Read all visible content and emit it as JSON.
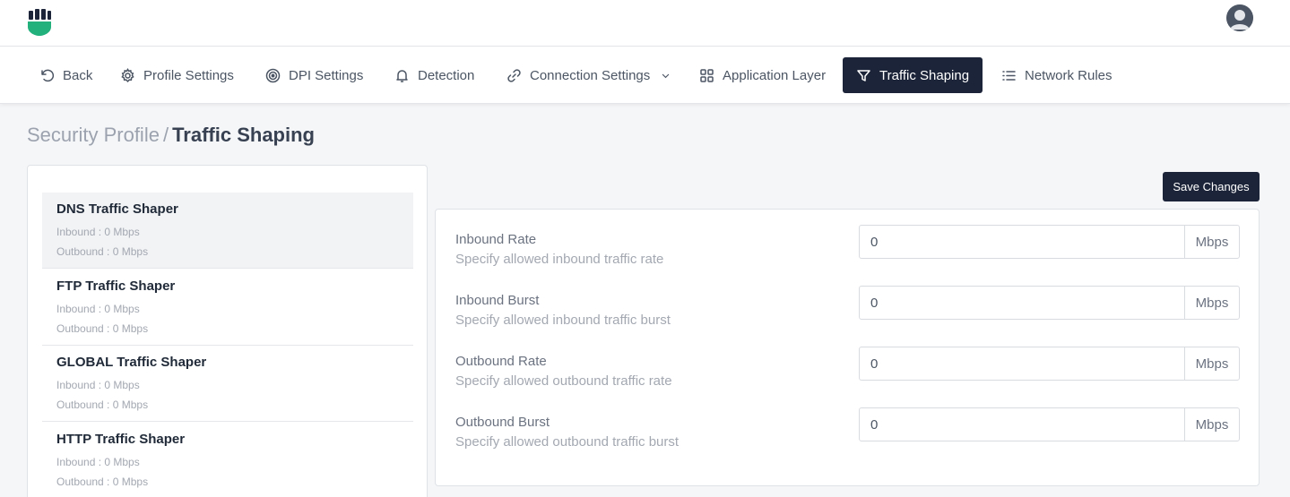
{
  "nav": {
    "back": "Back",
    "profile_settings": "Profile Settings",
    "dpi_settings": "DPI Settings",
    "detection": "Detection",
    "connection_settings": "Connection Settings",
    "application_layer": "Application Layer",
    "traffic_shaping": "Traffic Shaping",
    "network_rules": "Network Rules"
  },
  "breadcrumb": {
    "parent": "Security Profile",
    "separator": "/",
    "current": "Traffic Shaping"
  },
  "shapers": [
    {
      "title": "DNS Traffic Shaper",
      "inbound": "Inbound : 0 Mbps",
      "outbound": "Outbound : 0 Mbps",
      "selected": true
    },
    {
      "title": "FTP Traffic Shaper",
      "inbound": "Inbound : 0 Mbps",
      "outbound": "Outbound : 0 Mbps"
    },
    {
      "title": "GLOBAL Traffic Shaper",
      "inbound": "Inbound : 0 Mbps",
      "outbound": "Outbound : 0 Mbps"
    },
    {
      "title": "HTTP Traffic Shaper",
      "inbound": "Inbound : 0 Mbps",
      "outbound": "Outbound : 0 Mbps"
    }
  ],
  "save_label": "Save Changes",
  "fields": [
    {
      "label": "Inbound Rate",
      "help": "Specify allowed inbound traffic rate",
      "value": "0",
      "unit": "Mbps"
    },
    {
      "label": "Inbound Burst",
      "help": "Specify allowed inbound traffic burst",
      "value": "0",
      "unit": "Mbps"
    },
    {
      "label": "Outbound Rate",
      "help": "Specify allowed outbound traffic rate",
      "value": "0",
      "unit": "Mbps"
    },
    {
      "label": "Outbound Burst",
      "help": "Specify allowed outbound traffic burst",
      "value": "0",
      "unit": "Mbps"
    }
  ],
  "colors": {
    "logo_green": "#22b07d",
    "dark_navy": "#1b2438"
  }
}
